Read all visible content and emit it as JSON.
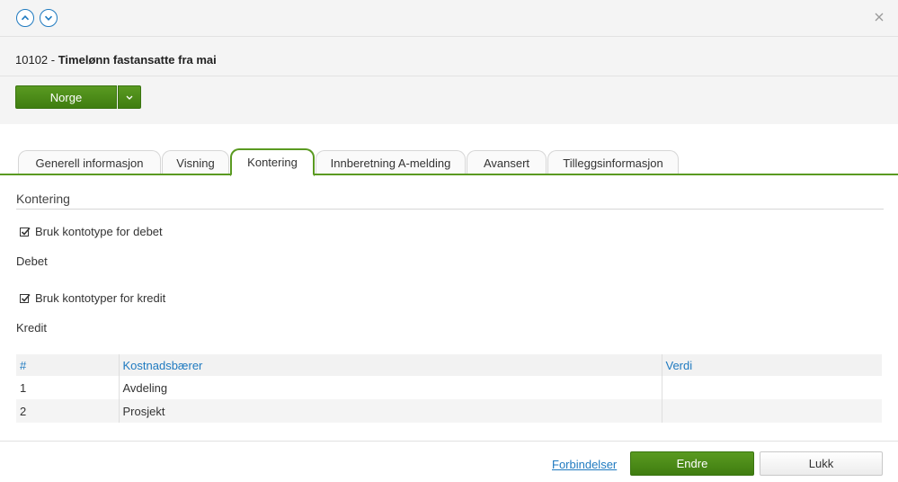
{
  "header": {
    "record_id": "10102",
    "separator": " - ",
    "record_name": "Timelønn fastansatte fra mai"
  },
  "actions": {
    "country": "Norge"
  },
  "tabs": [
    {
      "label": "Generell informasjon",
      "active": false
    },
    {
      "label": "Visning",
      "active": false
    },
    {
      "label": "Kontering",
      "active": true
    },
    {
      "label": "Innberetning A-melding",
      "active": false
    },
    {
      "label": "Avansert",
      "active": false
    },
    {
      "label": "Tilleggsinformasjon",
      "active": false
    }
  ],
  "section": {
    "title": "Kontering",
    "debet_checkbox": {
      "label": "Bruk kontotype for debet",
      "checked": true
    },
    "debet_label": "Debet",
    "kredit_checkbox": {
      "label": "Bruk kontotyper for kredit",
      "checked": true
    },
    "kredit_label": "Kredit"
  },
  "table": {
    "columns": [
      "#",
      "Kostnadsbærer",
      "Verdi"
    ],
    "rows": [
      [
        "1",
        "Avdeling",
        ""
      ],
      [
        "2",
        "Prosjekt",
        ""
      ]
    ]
  },
  "footer": {
    "link": "Forbindelser",
    "primary": "Endre",
    "secondary": "Lukk"
  },
  "colors": {
    "accent_green": "#5a9a21",
    "link_blue": "#1f7ac0"
  }
}
